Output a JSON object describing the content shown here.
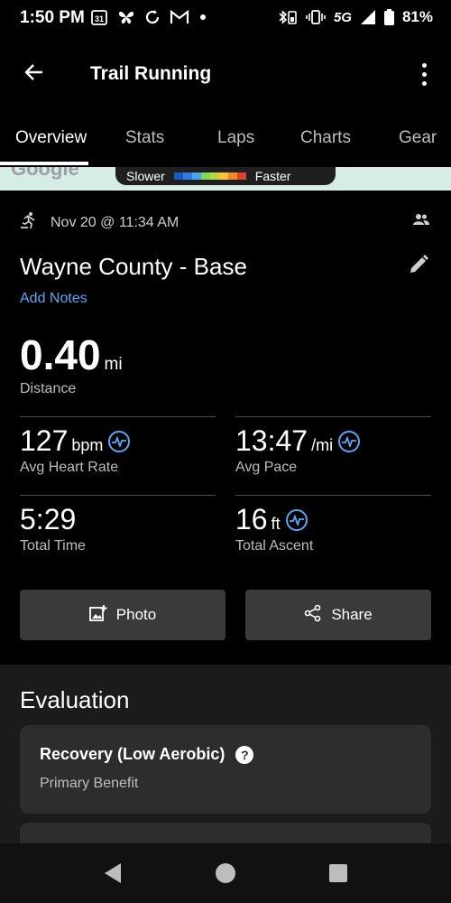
{
  "status": {
    "time": "1:50 PM",
    "calendar_day": "31",
    "network": "5G",
    "battery": "81%",
    "icons": [
      "calendar-icon",
      "butterfly-icon",
      "sync-icon",
      "gmail-icon",
      "dot-icon",
      "bluetooth-icon",
      "vibrate-icon",
      "signal-icon",
      "battery-icon"
    ]
  },
  "app_bar": {
    "title": "Trail Running",
    "back_icon": "arrow-back-icon",
    "menu_icon": "more-vert-icon"
  },
  "tabs": [
    {
      "label": "Overview",
      "active": true
    },
    {
      "label": "Stats",
      "active": false
    },
    {
      "label": "Laps",
      "active": false
    },
    {
      "label": "Charts",
      "active": false
    },
    {
      "label": "Gear",
      "active": false
    }
  ],
  "map": {
    "attribution": "Google",
    "legend_slow": "Slower",
    "legend_fast": "Faster",
    "legend_colors": [
      "#1a56c4",
      "#2f7de0",
      "#4aa3f0",
      "#7ed957",
      "#b7d93a",
      "#f7c23a",
      "#f08a24",
      "#e2402b"
    ]
  },
  "activity": {
    "date": "Nov 20 @ 11:34 AM",
    "name": "Wayne County - Base",
    "add_notes": "Add Notes"
  },
  "distance": {
    "value": "0.40",
    "unit": "mi",
    "label": "Distance"
  },
  "stats": [
    {
      "value": "127",
      "unit": "bpm",
      "label": "Avg Heart Rate",
      "has_chart_icon": true
    },
    {
      "value": "13:47",
      "unit": "/mi",
      "label": "Avg Pace",
      "has_chart_icon": true
    },
    {
      "value": "5:29",
      "unit": "",
      "label": "Total Time",
      "has_chart_icon": false
    },
    {
      "value": "16",
      "unit": "ft",
      "label": "Total Ascent",
      "has_chart_icon": true
    }
  ],
  "actions": {
    "photo": "Photo",
    "share": "Share"
  },
  "evaluation": {
    "title": "Evaluation",
    "card_title": "Recovery (Low Aerobic)",
    "card_subtitle": "Primary Benefit"
  },
  "colors": {
    "accent": "#5aa7f4",
    "background": "#000000",
    "card": "#2d2d2d"
  }
}
